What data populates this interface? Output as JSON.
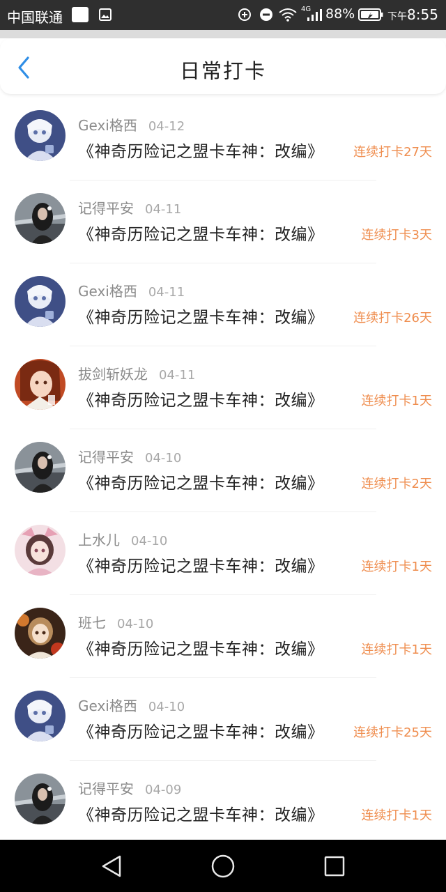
{
  "status_bar": {
    "carrier": "中国联通",
    "battery_percent": "88%",
    "time_prefix": "下午",
    "time": "8:55",
    "network": "4G"
  },
  "header": {
    "title": "日常打卡"
  },
  "colors": {
    "accent_blue": "#2f8ee6",
    "streak_orange": "#ef8d4e"
  },
  "entries": [
    {
      "user": "Gexi格西",
      "date": "04-12",
      "book": "《神奇历险记之盟卡车神：改编》",
      "streak": "连续打卡27天",
      "avatar": "avatar-blue-anime"
    },
    {
      "user": "记得平安",
      "date": "04-11",
      "book": "《神奇历险记之盟卡车神：改编》",
      "streak": "连续打卡3天",
      "avatar": "avatar-girl-street"
    },
    {
      "user": "Gexi格西",
      "date": "04-11",
      "book": "《神奇历险记之盟卡车神：改编》",
      "streak": "连续打卡26天",
      "avatar": "avatar-blue-anime"
    },
    {
      "user": "拔剑斩妖龙",
      "date": "04-11",
      "book": "《神奇历险记之盟卡车神：改编》",
      "streak": "连续打卡1天",
      "avatar": "avatar-orange-anime"
    },
    {
      "user": "记得平安",
      "date": "04-10",
      "book": "《神奇历险记之盟卡车神：改编》",
      "streak": "连续打卡2天",
      "avatar": "avatar-girl-street"
    },
    {
      "user": "上水儿",
      "date": "04-10",
      "book": "《神奇历险记之盟卡车神：改编》",
      "streak": "连续打卡1天",
      "avatar": "avatar-pink-anime"
    },
    {
      "user": "班七",
      "date": "04-10",
      "book": "《神奇历险记之盟卡车神：改编》",
      "streak": "连续打卡1天",
      "avatar": "avatar-autumn-anime"
    },
    {
      "user": "Gexi格西",
      "date": "04-10",
      "book": "《神奇历险记之盟卡车神：改编》",
      "streak": "连续打卡25天",
      "avatar": "avatar-blue-anime"
    },
    {
      "user": "记得平安",
      "date": "04-09",
      "book": "《神奇历险记之盟卡车神：改编》",
      "streak": "连续打卡1天",
      "avatar": "avatar-girl-street"
    }
  ]
}
